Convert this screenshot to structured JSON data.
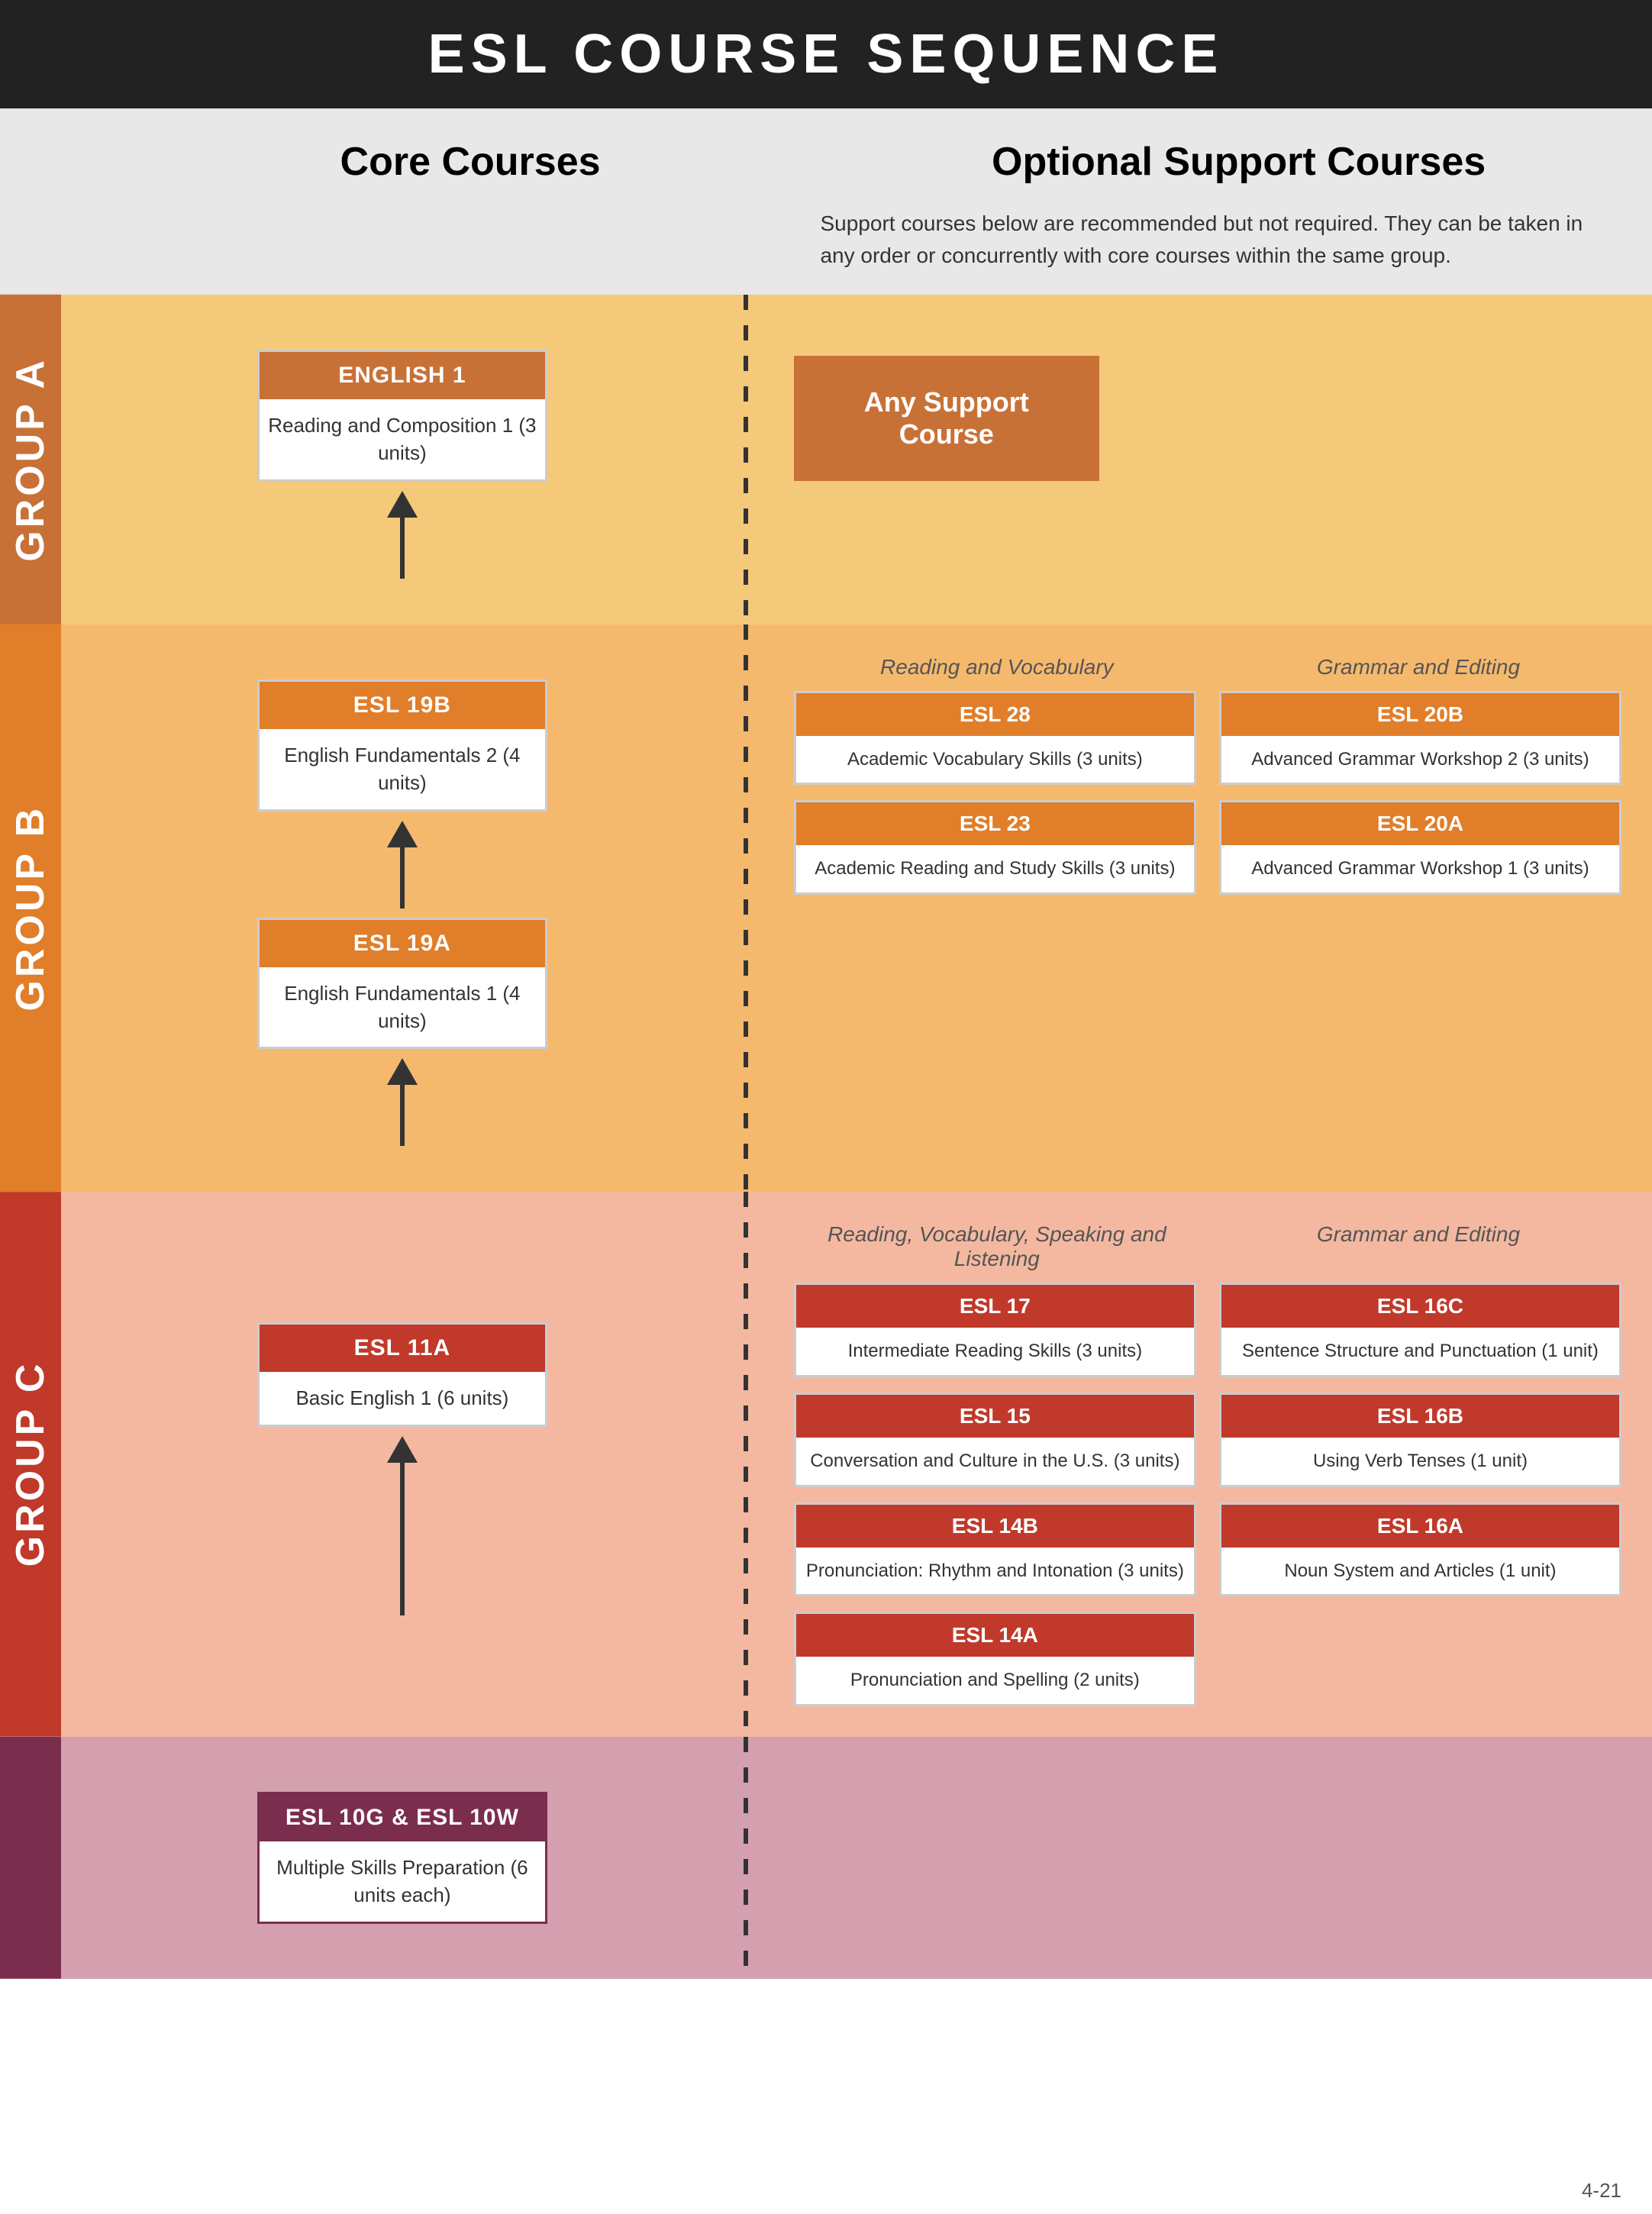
{
  "header": {
    "title": "ESL COURSE SEQUENCE"
  },
  "columns": {
    "core": "Core Courses",
    "optional": "Optional Support Courses",
    "optional_desc": "Support courses below are recommended but not required. They can be taken in any order or concurrently with core courses within the same group."
  },
  "groups": {
    "a": {
      "label": "GROUP A",
      "core": {
        "title": "ENGLISH 1",
        "desc": "Reading and Composition 1 (3 units)"
      },
      "optional": {
        "any_support": "Any Support Course"
      }
    },
    "b": {
      "label": "GROUP B",
      "core": [
        {
          "title": "ESL 19B",
          "desc": "English Fundamentals 2 (4 units)"
        },
        {
          "title": "ESL 19A",
          "desc": "English Fundamentals 1 (4 units)"
        }
      ],
      "support_cats": {
        "left": "Reading and Vocabulary",
        "right": "Grammar and Editing"
      },
      "optional_left": [
        {
          "title": "ESL 28",
          "desc": "Academic Vocabulary Skills (3 units)"
        },
        {
          "title": "ESL 23",
          "desc": "Academic Reading and Study Skills (3 units)"
        }
      ],
      "optional_right": [
        {
          "title": "ESL 20B",
          "desc": "Advanced Grammar Workshop 2 (3 units)"
        },
        {
          "title": "ESL 20A",
          "desc": "Advanced Grammar Workshop 1 (3 units)"
        }
      ]
    },
    "c": {
      "label": "GROUP C",
      "core": {
        "title": "ESL 11A",
        "desc": "Basic English 1 (6 units)"
      },
      "support_cats": {
        "left": "Reading, Vocabulary, Speaking and Listening",
        "right": "Grammar and Editing"
      },
      "optional_left": [
        {
          "title": "ESL 17",
          "desc": "Intermediate Reading Skills (3 units)"
        },
        {
          "title": "ESL 15",
          "desc": "Conversation and Culture in the U.S. (3 units)"
        },
        {
          "title": "ESL 14B",
          "desc": "Pronunciation: Rhythm and Intonation (3 units)"
        },
        {
          "title": "ESL 14A",
          "desc": "Pronunciation and Spelling (2 units)"
        }
      ],
      "optional_right": [
        {
          "title": "ESL 16C",
          "desc": "Sentence Structure and Punctuation (1 unit)"
        },
        {
          "title": "ESL 16B",
          "desc": "Using Verb Tenses (1 unit)"
        },
        {
          "title": "ESL 16A",
          "desc": "Noun System and Articles (1 unit)"
        }
      ]
    },
    "d": {
      "label": "",
      "core": {
        "title": "ESL 10G & ESL 10W",
        "desc": "Multiple Skills Preparation (6 units each)"
      }
    }
  },
  "footer": {
    "note": "4-21"
  }
}
